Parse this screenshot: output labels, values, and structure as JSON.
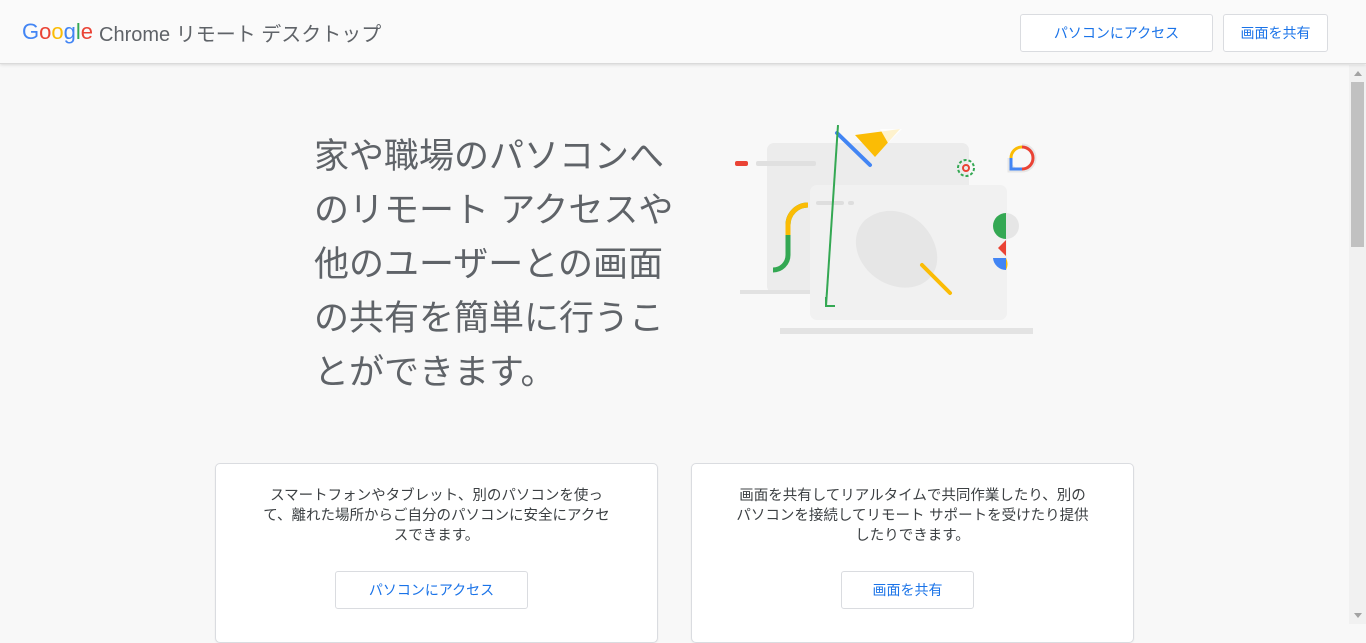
{
  "header": {
    "logo_google_letters": [
      "G",
      "o",
      "o",
      "g",
      "l",
      "e"
    ],
    "logo_colors": [
      "#4285F4",
      "#EA4335",
      "#FBBC05",
      "#4285F4",
      "#34A853",
      "#EA4335"
    ],
    "product_name": "Chrome リモート デスクトップ",
    "access_button": "パソコンにアクセス",
    "share_button": "画面を共有"
  },
  "hero": {
    "lines": [
      "家や職場のパソコンへ",
      "のリモート アクセスや",
      "他のユーザーとの画面",
      "の共有を簡単に行うこ",
      "とができます。"
    ]
  },
  "cards": [
    {
      "lines": [
        "スマートフォンやタブレット、別のパソコンを使っ",
        "て、離れた場所からご自分のパソコンに安全にアクセ",
        "スできます。"
      ],
      "button": "パソコンにアクセス"
    },
    {
      "lines": [
        "画面を共有してリアルタイムで共同作業したり、別の",
        "パソコンを接続してリモート サポートを受けたり提供",
        "したりできます。"
      ],
      "button": "画面を共有"
    }
  ],
  "colors": {
    "accent_blue": "#1a73e8",
    "google_red": "#EA4335",
    "google_yellow": "#FBBC05",
    "google_green": "#34A853",
    "google_blue": "#4285F4"
  }
}
